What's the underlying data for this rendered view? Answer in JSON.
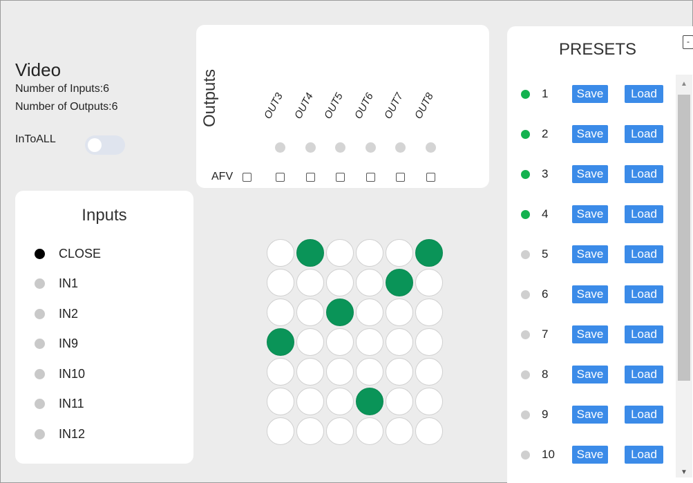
{
  "video": {
    "title": "Video",
    "inputs_count": "Number of Inputs:6",
    "outputs_count": "Number of Outputs:6",
    "intoall_label": "InToALL",
    "intoall_on": false
  },
  "inputs": {
    "title": "Inputs",
    "items": [
      {
        "label": "CLOSE",
        "active": true
      },
      {
        "label": "IN1",
        "active": false
      },
      {
        "label": "IN2",
        "active": false
      },
      {
        "label": "IN9",
        "active": false
      },
      {
        "label": "IN10",
        "active": false
      },
      {
        "label": "IN11",
        "active": false
      },
      {
        "label": "IN12",
        "active": false
      }
    ]
  },
  "outputs": {
    "title": "Outputs",
    "afv_label": "AFV",
    "items": [
      "OUT3",
      "OUT4",
      "OUT5",
      "OUT6",
      "OUT7",
      "OUT8"
    ]
  },
  "matrix": [
    [
      0,
      1,
      0,
      0,
      0,
      1
    ],
    [
      0,
      0,
      0,
      0,
      1,
      0
    ],
    [
      0,
      0,
      1,
      0,
      0,
      0
    ],
    [
      1,
      0,
      0,
      0,
      0,
      0
    ],
    [
      0,
      0,
      0,
      0,
      0,
      0
    ],
    [
      0,
      0,
      0,
      1,
      0,
      0
    ],
    [
      0,
      0,
      0,
      0,
      0,
      0
    ]
  ],
  "presets": {
    "title": "PRESETS",
    "save_label": "Save",
    "load_label": "Load",
    "items": [
      {
        "num": "1",
        "active": true
      },
      {
        "num": "2",
        "active": true
      },
      {
        "num": "3",
        "active": true
      },
      {
        "num": "4",
        "active": true
      },
      {
        "num": "5",
        "active": false
      },
      {
        "num": "6",
        "active": false
      },
      {
        "num": "7",
        "active": false
      },
      {
        "num": "8",
        "active": false
      },
      {
        "num": "9",
        "active": false
      },
      {
        "num": "10",
        "active": false
      }
    ]
  },
  "corner_button": "-",
  "colors": {
    "matrix_on": "#0a9458",
    "preset_active": "#13b24f",
    "button": "#3b8be8"
  },
  "icons": {
    "scroll_up": "triangle-up-icon",
    "scroll_down": "triangle-down-icon"
  }
}
